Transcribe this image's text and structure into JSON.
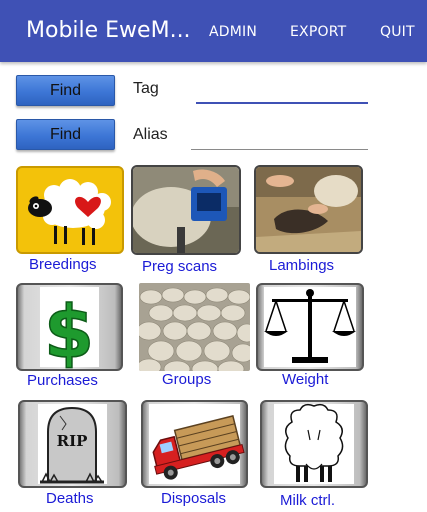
{
  "app": {
    "title": "Mobile EweM...",
    "menu": [
      "ADMIN",
      "EXPORT",
      "QUIT"
    ]
  },
  "search": {
    "tag": {
      "button": "Find",
      "label": "Tag",
      "value": ""
    },
    "alias": {
      "button": "Find",
      "label": "Alias",
      "value": ""
    }
  },
  "tiles": [
    {
      "label": "Breedings",
      "icon": "sheep-heart-icon"
    },
    {
      "label": "Preg scans",
      "icon": "ultrasound-photo"
    },
    {
      "label": "Lambings",
      "icon": "lambing-photo"
    },
    {
      "label": "Purchases",
      "icon": "dollar-sign-icon"
    },
    {
      "label": "Groups",
      "icon": "sheep-flock-photo"
    },
    {
      "label": "Weight",
      "icon": "scales-icon"
    },
    {
      "label": "Deaths",
      "icon": "tombstone-icon"
    },
    {
      "label": "Disposals",
      "icon": "truck-icon"
    },
    {
      "label": "Milk ctrl.",
      "icon": "ewe-udder-icon"
    }
  ],
  "colors": {
    "appbar": "#3f51b5",
    "find_button": "#3d76d6",
    "tile_label": "#1b1bd6"
  }
}
